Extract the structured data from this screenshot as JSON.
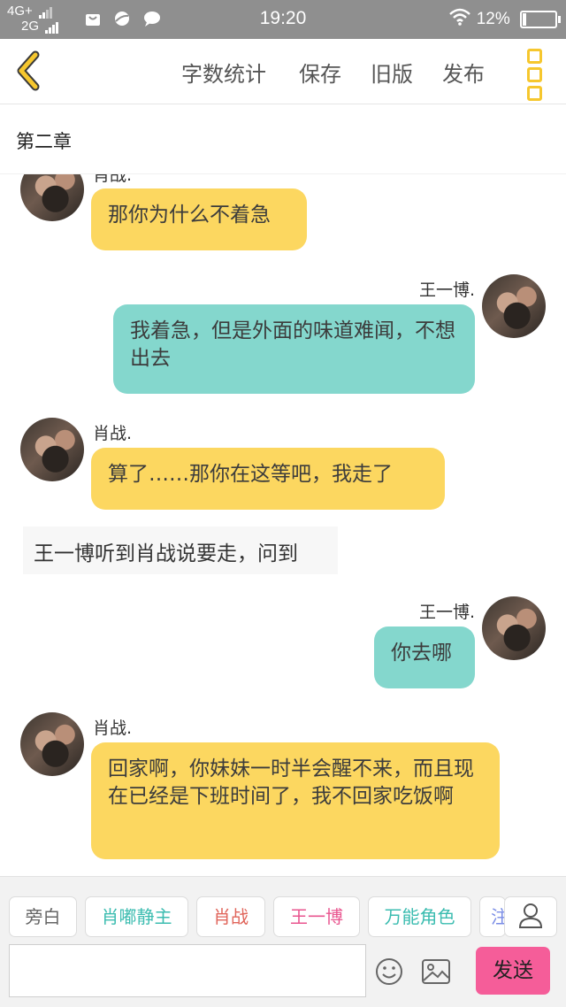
{
  "status_bar": {
    "network_top": "4G+",
    "network_bottom": "2G",
    "time": "19:20",
    "battery_percent": "12%",
    "battery_level": 0.12
  },
  "toolbar": {
    "back_icon": "chevron-left-icon",
    "menu": [
      "字数统计",
      "保存",
      "旧版",
      "发布"
    ],
    "more_icon": "more-vertical-icon",
    "accent_color": "#f6c72e"
  },
  "chapter_title": "第二章",
  "messages": [
    {
      "speaker": "肖战.",
      "text": "那你为什么不着急",
      "side": "left",
      "color": "#fcd760"
    },
    {
      "speaker": "王一博.",
      "text": "我着急，但是外面的味道难闻，不想出去",
      "side": "right",
      "color": "#84d7cd"
    },
    {
      "speaker": "肖战.",
      "text": "算了……那你在这等吧，我走了",
      "side": "left",
      "color": "#fcd760"
    },
    {
      "narration": "王一博听到肖战说要走，问到"
    },
    {
      "speaker": "王一博.",
      "text": "你去哪",
      "side": "right",
      "color": "#84d7cd"
    },
    {
      "speaker": "肖战.",
      "text": "回家啊，你妹妹一时半会醒不来，而且现在已经是下班时间了，我不回家吃饭啊",
      "side": "left",
      "color": "#fcd760"
    }
  ],
  "roles": [
    {
      "label": "旁白",
      "color": "#666666"
    },
    {
      "label": "肖嘟静主",
      "color": "#3bbcb0"
    },
    {
      "label": "肖战",
      "color": "#e0645a"
    },
    {
      "label": "王一博",
      "color": "#e9558f"
    },
    {
      "label": "万能角色",
      "color": "#3bbcb0"
    },
    {
      "label": "注",
      "color": "#7a8de6"
    }
  ],
  "input": {
    "placeholder": "",
    "value": "",
    "send_label": "发送",
    "send_color": "#f55d99"
  }
}
